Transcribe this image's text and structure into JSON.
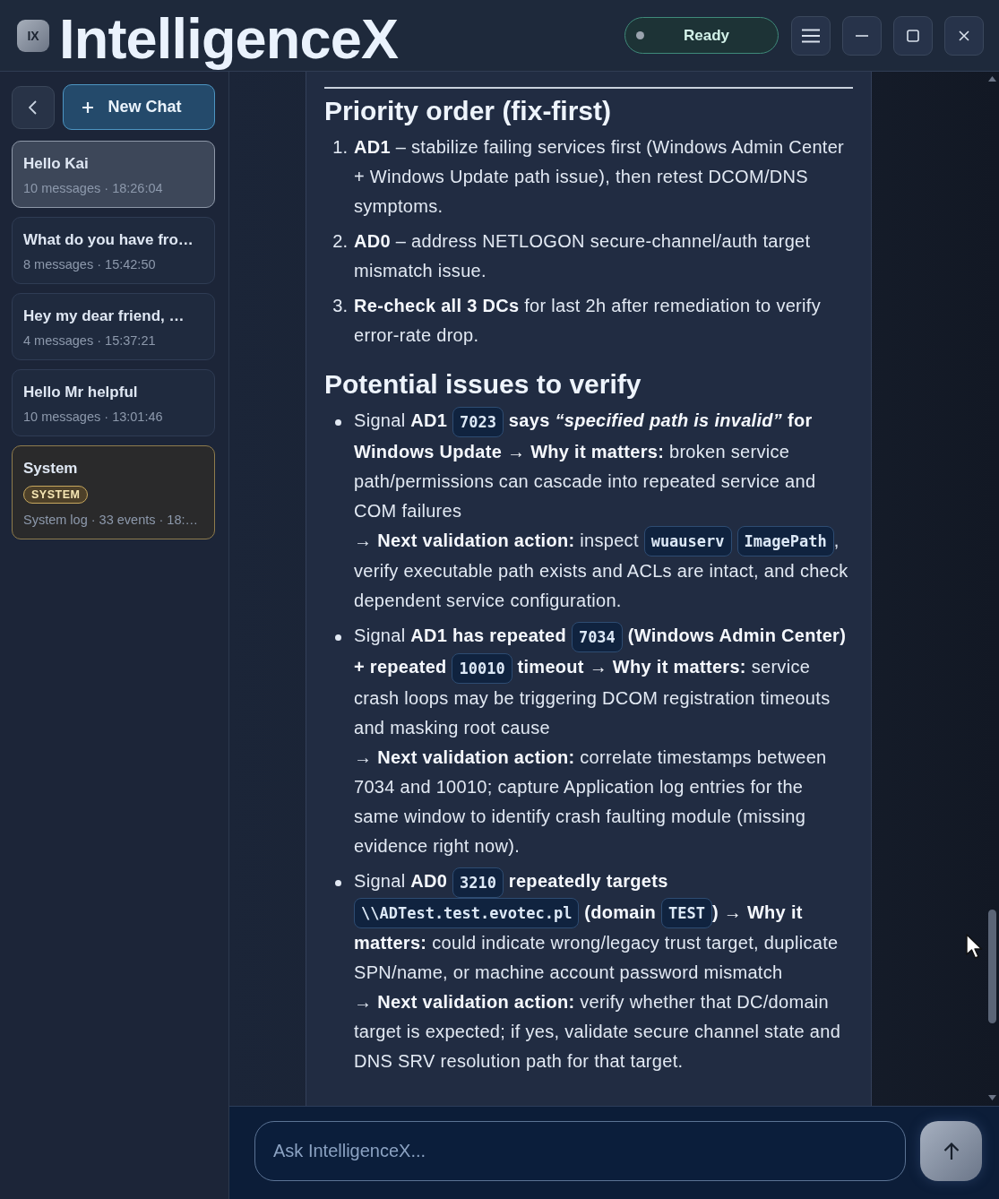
{
  "app": {
    "logo": "IX",
    "title": "IntelligenceX",
    "status": "Ready"
  },
  "sidebar": {
    "new_chat": "New Chat",
    "conversations": [
      {
        "kind": "chat",
        "title": "Hello Kai",
        "meta": "10 messages · 18:26:04",
        "selected": true
      },
      {
        "kind": "chat",
        "title": "What do you have fro…",
        "meta": "8 messages · 15:42:50",
        "selected": false
      },
      {
        "kind": "chat",
        "title": "Hey my dear friend, …",
        "meta": "4 messages · 15:37:21",
        "selected": false
      },
      {
        "kind": "chat",
        "title": "Hello Mr helpful",
        "meta": "10 messages · 13:01:46",
        "selected": false
      },
      {
        "kind": "system",
        "title": "System",
        "badge": "SYSTEM",
        "meta": "System log · 33 events · 18:…",
        "selected": false
      }
    ]
  },
  "message": {
    "sections": [
      {
        "heading": "Priority order (fix-first)",
        "items": [
          {
            "number": "1.",
            "lines": [
              [
                {
                  "kind": "text",
                  "text": "**AD1** – stabilize failing services first (Windows Admin Center + Windows Update path issue), then retest DCOM/DNS symptoms."
                }
              ]
            ]
          },
          {
            "number": "2.",
            "lines": [
              [
                {
                  "kind": "text",
                  "text": "**AD0** – address NETLOGON secure-channel/auth target mismatch issue."
                }
              ]
            ]
          },
          {
            "number": "3.",
            "lines": [
              [
                {
                  "kind": "text",
                  "text": "**Re-check all 3 DCs** for last 2h after remediation to verify error-rate drop."
                }
              ]
            ]
          }
        ]
      },
      {
        "heading": "Potential issues to verify",
        "items": [
          {
            "lines": [
              [
                {
                  "kind": "text",
                  "text": "Signal **AD1** "
                },
                {
                  "kind": "code",
                  "text": "7023"
                },
                {
                  "kind": "text",
                  "text": " **says *“specified path is invalid”* for Windows Update → Why it matters:** broken service path/permissions can cascade into repeated service and COM failures"
                }
              ],
              [
                {
                  "kind": "text",
                  "text": "→ **Next validation action:** inspect "
                },
                {
                  "kind": "code",
                  "text": "wuauserv"
                },
                {
                  "kind": "code",
                  "text": "ImagePath"
                },
                {
                  "kind": "text",
                  "text": ", verify executable path exists and ACLs are intact, and check dependent service configuration."
                }
              ]
            ]
          },
          {
            "lines": [
              [
                {
                  "kind": "text",
                  "text": "Signal **AD1 has repeated** "
                },
                {
                  "kind": "code",
                  "text": "7034"
                },
                {
                  "kind": "text",
                  "text": " **(Windows Admin Center) + repeated** "
                },
                {
                  "kind": "code",
                  "text": "10010"
                },
                {
                  "kind": "text",
                  "text": " **timeout → Why it matters:** service crash loops may be triggering DCOM registration timeouts and masking root cause"
                }
              ],
              [
                {
                  "kind": "text",
                  "text": "→ **Next validation action:** correlate timestamps between 7034 and 10010; capture Application log entries for the same window to identify crash faulting module (missing evidence right now)."
                }
              ]
            ]
          },
          {
            "lines": [
              [
                {
                  "kind": "text",
                  "text": "Signal **AD0** "
                },
                {
                  "kind": "code",
                  "text": "3210"
                },
                {
                  "kind": "text",
                  "text": " **repeatedly targets** "
                },
                {
                  "kind": "code",
                  "text": "\\\\ADTest.test.evotec.pl"
                },
                {
                  "kind": "text",
                  "text": " **(domain** "
                },
                {
                  "kind": "code",
                  "text": "TEST"
                },
                {
                  "kind": "text",
                  "text": "**) → Why it matters:** could indicate wrong/legacy trust target, duplicate SPN/name, or machine account password mismatch"
                }
              ],
              [
                {
                  "kind": "text",
                  "text": "→ **Next validation action:** verify whether that DC/domain target is expected; if yes, validate secure channel state and DNS SRV resolution path for that target."
                }
              ]
            ]
          }
        ]
      }
    ]
  },
  "composer": {
    "placeholder": "Ask IntelligenceX..."
  }
}
